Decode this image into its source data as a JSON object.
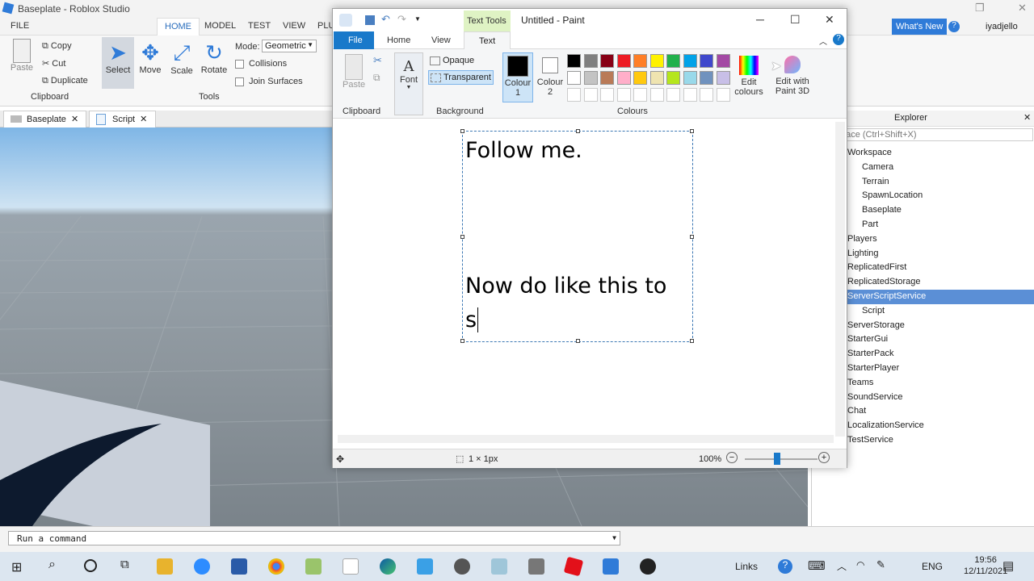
{
  "roblox": {
    "title": "Baseplate - Roblox Studio",
    "menu_tabs": [
      "FILE",
      "HOME",
      "MODEL",
      "TEST",
      "VIEW",
      "PLU"
    ],
    "ribbon": {
      "paste": "Paste",
      "copy": "Copy",
      "cut": "Cut",
      "duplicate": "Duplicate",
      "clipboard": "Clipboard",
      "select": "Select",
      "move": "Move",
      "scale": "Scale",
      "rotate": "Rotate",
      "tools": "Tools",
      "mode_label": "Mode:",
      "mode_value": "Geometric",
      "collisions": "Collisions",
      "join_surfaces": "Join Surfaces"
    },
    "whats_new": "What's New",
    "user": "iyadjello",
    "doc_tabs": [
      "Baseplate",
      "Script"
    ],
    "explorer": {
      "title": "Explorer",
      "filter_placeholder": "Workspace (Ctrl+Shift+X)",
      "items": [
        "Workspace",
        "Camera",
        "Terrain",
        "SpawnLocation",
        "Baseplate",
        "Part",
        "Players",
        "Lighting",
        "ReplicatedFirst",
        "ReplicatedStorage",
        "ServerScriptService",
        "Script",
        "ServerStorage",
        "StarterGui",
        "StarterPack",
        "StarterPlayer",
        "Teams",
        "SoundService",
        "Chat",
        "LocalizationService",
        "TestService"
      ],
      "selected": "ServerScriptService"
    },
    "command_placeholder": "Run a command"
  },
  "paint": {
    "title": "Untitled - Paint",
    "text_tools": "Text Tools",
    "tabs": {
      "file": "File",
      "home": "Home",
      "view": "View",
      "text": "Text"
    },
    "ribbon": {
      "paste": "Paste",
      "clipboard": "Clipboard",
      "font": "Font",
      "opaque": "Opaque",
      "transparent": "Transparent",
      "background": "Background",
      "colour1": "Colour 1",
      "colour2": "Colour 2",
      "colours": "Colours",
      "edit_colours": "Edit colours",
      "edit_paint3d": "Edit with Paint 3D"
    },
    "palette_row1": [
      "#000000",
      "#7f7f7f",
      "#880015",
      "#ed1c24",
      "#ff7f27",
      "#fff200",
      "#22b14c",
      "#00a2e8",
      "#3f48cc",
      "#a349a4"
    ],
    "palette_row2": [
      "#ffffff",
      "#c3c3c3",
      "#b97a57",
      "#ffaec9",
      "#ffc90e",
      "#efe4b0",
      "#b5e61d",
      "#99d9ea",
      "#7092be",
      "#c8bfe7"
    ],
    "canvas_text": {
      "line1": "Follow me.",
      "line2": "Now do like this to",
      "line3": "s"
    },
    "status": {
      "selection": "1 × 1px",
      "zoom": "100%"
    }
  },
  "taskbar": {
    "links": "Links",
    "lang": "ENG",
    "time": "19:56",
    "date": "12/11/2021"
  }
}
